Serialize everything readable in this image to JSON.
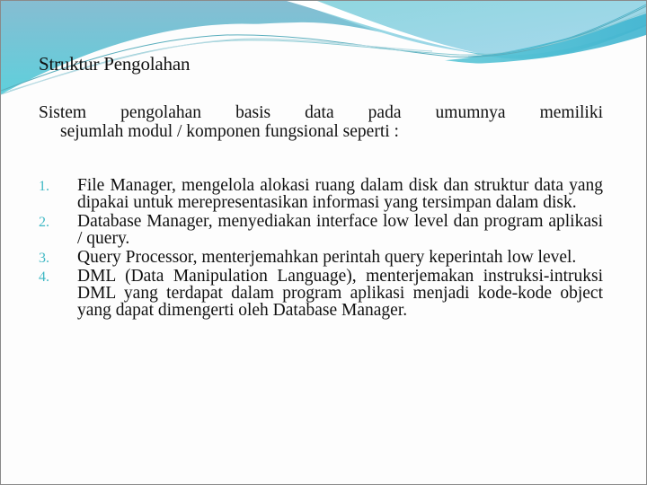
{
  "slide": {
    "title": "Struktur Pengolahan",
    "intro": {
      "line1": "Sistem pengolahan basis data pada umumnya memiliki",
      "line2": "sejumlah modul / komponen fungsional seperti :"
    },
    "items": [
      {
        "number": "1.",
        "text": "File Manager, mengelola alokasi ruang dalam disk dan struktur data yang dipakai untuk merepresentasikan informasi yang tersimpan dalam disk."
      },
      {
        "number": "2.",
        "text": "Database Manager, menyediakan interface low level dan program aplikasi / query."
      },
      {
        "number": "3.",
        "text": "Query Processor, menterjemahkan perintah query keperintah low level."
      },
      {
        "number": "4.",
        "text": "DML (Data Manipulation Language), menterjemakan instruksi-intruksi DML yang terdapat dalam program aplikasi menjadi kode-kode object yang dapat dimengerti oleh Database Manager."
      }
    ]
  },
  "theme": {
    "accent": "#3fb8c4",
    "wave_dark": "#7fbfd4",
    "wave_light": "#a8dbe8",
    "wave_teal": "#5cc8d6"
  }
}
